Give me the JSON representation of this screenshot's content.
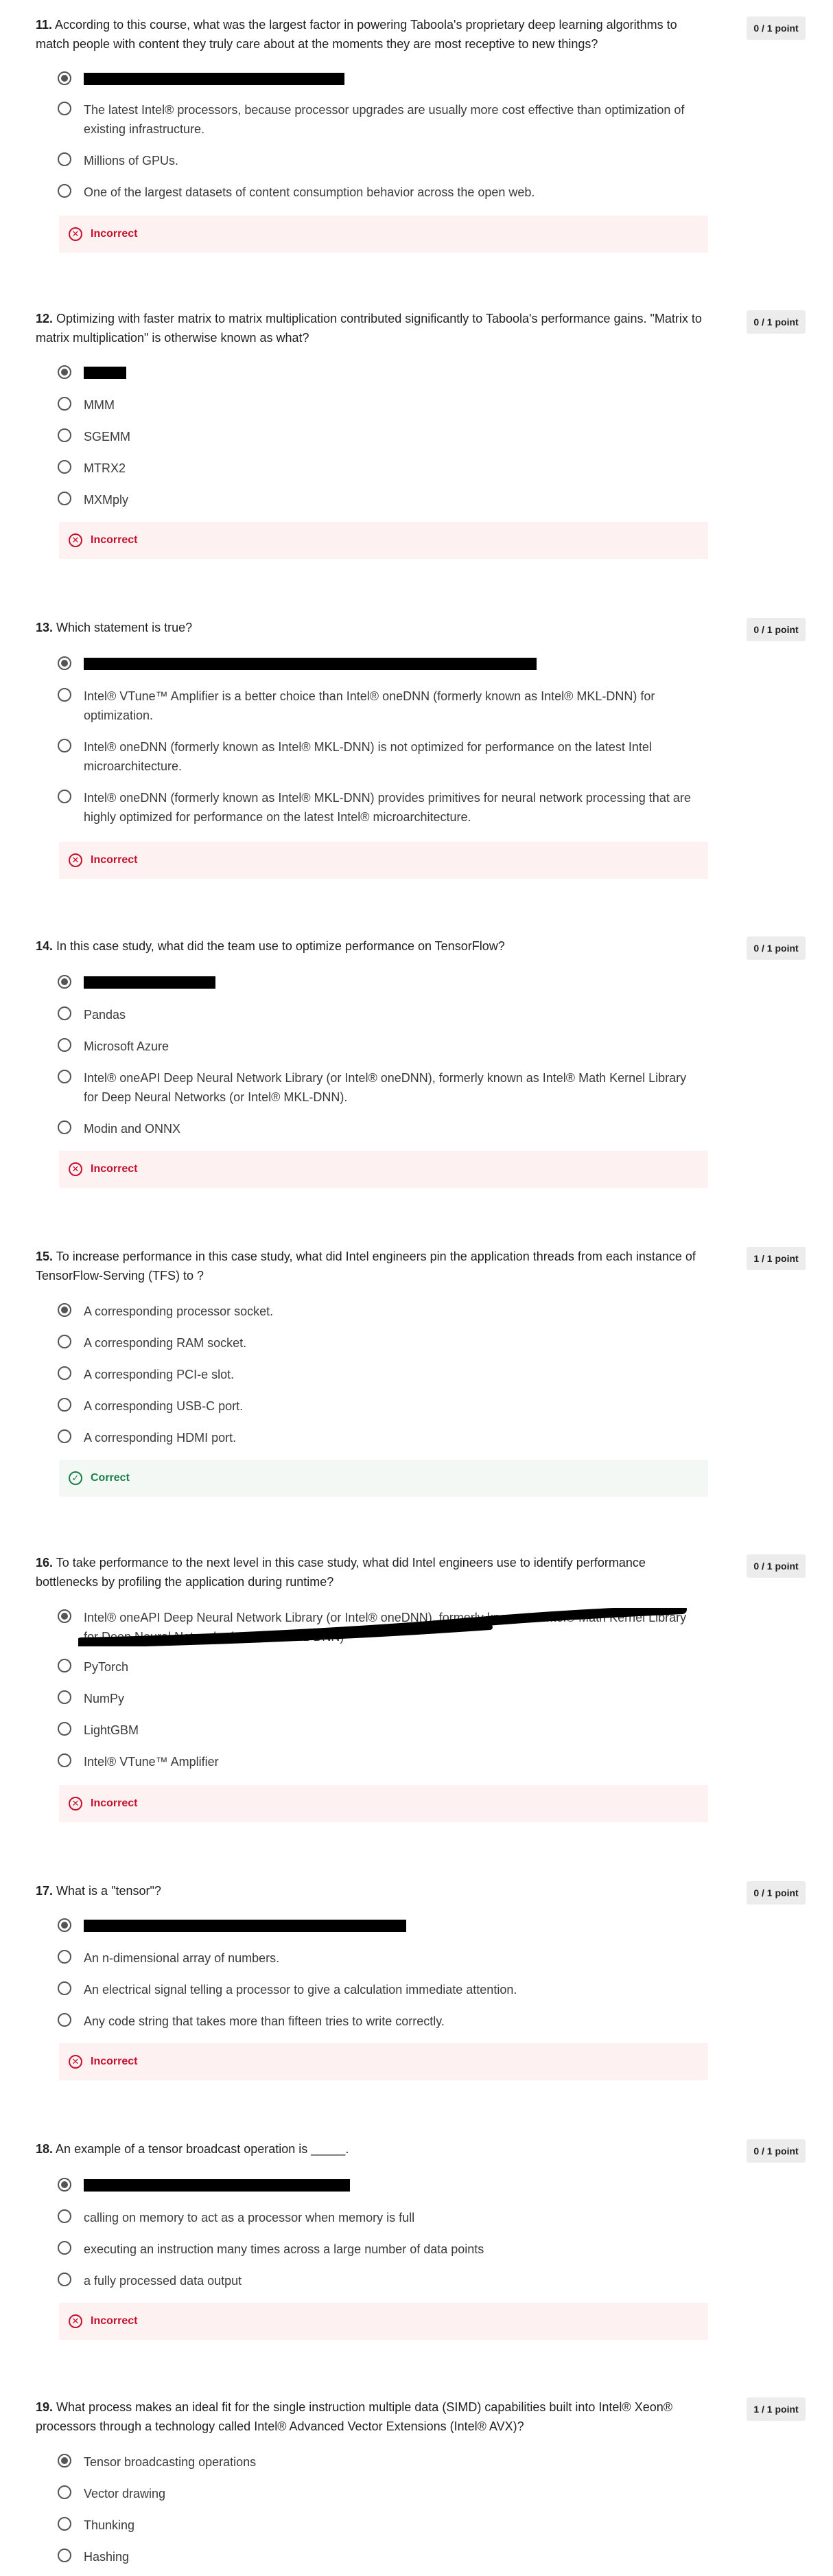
{
  "feedback_labels": {
    "incorrect": "Incorrect",
    "correct": "Correct",
    "incorrect_icon": "✕",
    "correct_icon": "✓"
  },
  "questions": [
    {
      "number": "11.",
      "text": "According to this course, what was the largest factor in powering Taboola's proprietary deep learning algorithms to match people with content they truly care about at the moments they are most receptive to new things?",
      "points": "0 / 1 point",
      "options": [
        {
          "label": "",
          "selected": true,
          "redacted": true
        },
        {
          "label": "The latest Intel® processors, because processor upgrades are usually more cost effective than optimization of existing infrastructure.",
          "selected": false
        },
        {
          "label": "Millions of GPUs.",
          "selected": false
        },
        {
          "label": "One of the largest datasets of content consumption behavior across the open web.",
          "selected": false
        }
      ],
      "result": "incorrect"
    },
    {
      "number": "12.",
      "text": "Optimizing with faster matrix to matrix multiplication contributed significantly to Taboola's performance gains. \"Matrix to matrix multiplication\" is otherwise known as what?",
      "points": "0 / 1 point",
      "options": [
        {
          "label": "",
          "selected": true,
          "redacted": true
        },
        {
          "label": "MMM",
          "selected": false
        },
        {
          "label": "SGEMM",
          "selected": false
        },
        {
          "label": "MTRX2",
          "selected": false
        },
        {
          "label": "MXMply",
          "selected": false
        }
      ],
      "result": "incorrect"
    },
    {
      "number": "13.",
      "text": "Which statement is true?",
      "points": "0 / 1 point",
      "options": [
        {
          "label": "",
          "selected": true,
          "redacted": true
        },
        {
          "label": "Intel® VTune™ Amplifier is a better choice than Intel® oneDNN (formerly known as Intel® MKL-DNN) for optimization.",
          "selected": false
        },
        {
          "label": "Intel® oneDNN (formerly known as Intel® MKL-DNN) is not optimized for performance on the latest Intel microarchitecture.",
          "selected": false
        },
        {
          "label": "Intel® oneDNN (formerly known as Intel® MKL-DNN) provides primitives for neural network processing that are highly optimized for performance on the latest Intel® microarchitecture.",
          "selected": false
        }
      ],
      "result": "incorrect"
    },
    {
      "number": "14.",
      "text": "In this case study, what did the team use to optimize performance on TensorFlow?",
      "points": "0 / 1 point",
      "options": [
        {
          "label": "",
          "selected": true,
          "redacted": true
        },
        {
          "label": "Pandas",
          "selected": false
        },
        {
          "label": "Microsoft Azure",
          "selected": false
        },
        {
          "label": "Intel® oneAPI Deep Neural Network Library (or Intel® oneDNN), formerly known as Intel® Math Kernel Library for Deep Neural Networks (or Intel® MKL-DNN).",
          "selected": false
        },
        {
          "label": "Modin and ONNX",
          "selected": false
        }
      ],
      "result": "incorrect"
    },
    {
      "number": "15.",
      "text": "To increase performance in this case study, what did Intel engineers pin the application threads from each instance of TensorFlow-Serving (TFS) to ?",
      "points": "1 / 1 point",
      "options": [
        {
          "label": "A corresponding processor socket.",
          "selected": true
        },
        {
          "label": "A corresponding RAM socket.",
          "selected": false
        },
        {
          "label": "A corresponding PCI-e slot.",
          "selected": false
        },
        {
          "label": "A corresponding USB-C port.",
          "selected": false
        },
        {
          "label": "A corresponding HDMI port.",
          "selected": false
        }
      ],
      "result": "correct"
    },
    {
      "number": "16.",
      "text": "To take performance to the next level in this case study, what did Intel engineers use to identify performance bottlenecks by profiling the application during runtime?",
      "points": "0 / 1 point",
      "options": [
        {
          "label": "Intel® oneAPI Deep Neural Network Library (or Intel® oneDNN), formerly known as Intel® Math Kernel Library for Deep Neural Networks (or Intel® MKL-DNN)",
          "selected": true,
          "scribbled": true
        },
        {
          "label": "PyTorch",
          "selected": false
        },
        {
          "label": "NumPy",
          "selected": false
        },
        {
          "label": "LightGBM",
          "selected": false
        },
        {
          "label": "Intel® VTune™ Amplifier",
          "selected": false
        }
      ],
      "result": "incorrect"
    },
    {
      "number": "17.",
      "text": "What is a \"tensor\"?",
      "points": "0 / 1 point",
      "options": [
        {
          "label": "",
          "selected": true,
          "redacted": true
        },
        {
          "label": "An n-dimensional array of numbers.",
          "selected": false
        },
        {
          "label": "An electrical signal telling a processor to give a calculation immediate attention.",
          "selected": false
        },
        {
          "label": "Any code string that takes more than fifteen tries to write correctly.",
          "selected": false
        }
      ],
      "result": "incorrect"
    },
    {
      "number": "18.",
      "text": "An example of a tensor broadcast operation is _____.",
      "points": "0 / 1 point",
      "options": [
        {
          "label": "",
          "selected": true,
          "redacted": true
        },
        {
          "label": "calling on memory to act as a processor when memory is full",
          "selected": false
        },
        {
          "label": "executing an instruction many times across a large number of data points",
          "selected": false
        },
        {
          "label": "a fully processed data output",
          "selected": false
        }
      ],
      "result": "incorrect"
    },
    {
      "number": "19.",
      "text": "What process makes an ideal fit for the single instruction multiple data (SIMD) capabilities built into Intel® Xeon® processors through a technology called Intel® Advanced Vector Extensions (Intel® AVX)?",
      "points": "1 / 1 point",
      "options": [
        {
          "label": "Tensor broadcasting operations",
          "selected": true
        },
        {
          "label": "Vector drawing",
          "selected": false
        },
        {
          "label": "Thunking",
          "selected": false
        },
        {
          "label": "Hashing",
          "selected": false
        }
      ],
      "result": null
    }
  ]
}
